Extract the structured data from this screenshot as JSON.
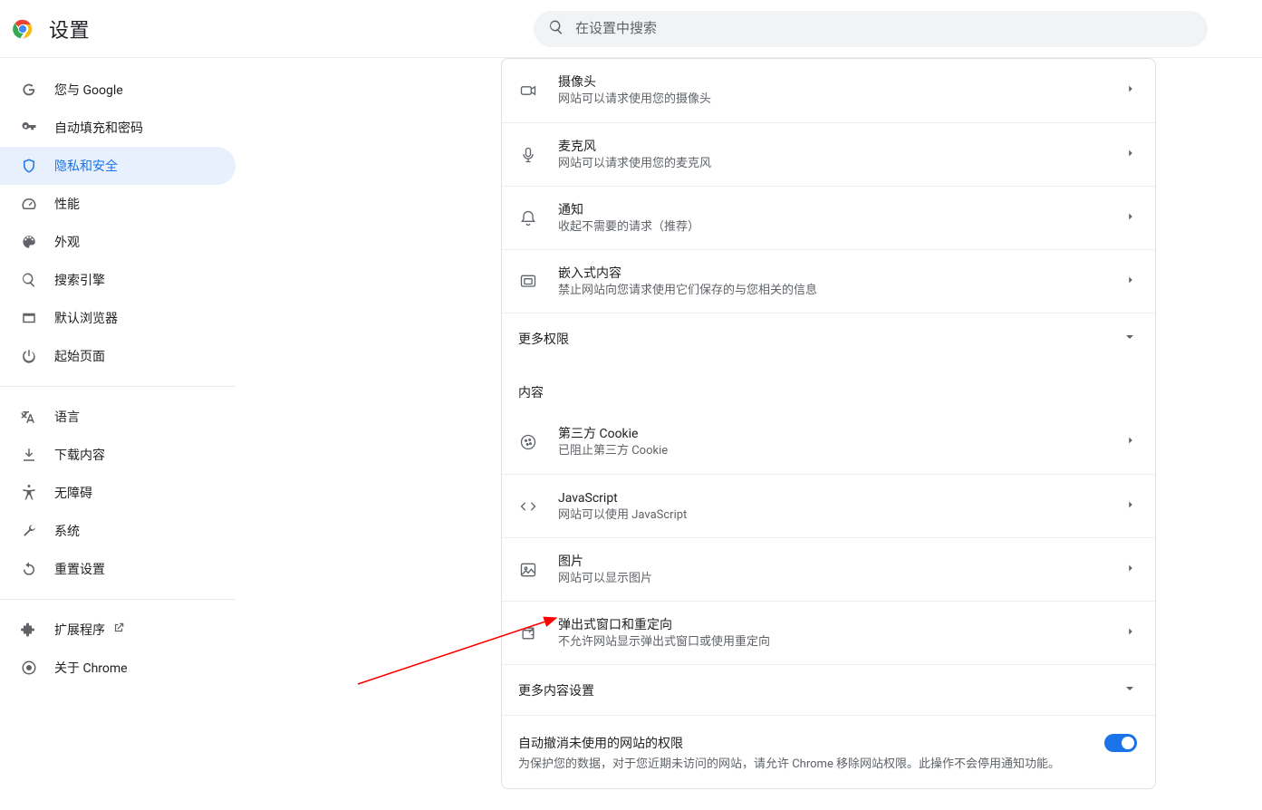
{
  "header": {
    "title": "设置",
    "search_placeholder": "在设置中搜索"
  },
  "sidebar": {
    "items": [
      {
        "label": "您与 Google",
        "name": "sidebar-item-you-and-google"
      },
      {
        "label": "自动填充和密码",
        "name": "sidebar-item-autofill"
      },
      {
        "label": "隐私和安全",
        "name": "sidebar-item-privacy",
        "active": true
      },
      {
        "label": "性能",
        "name": "sidebar-item-performance"
      },
      {
        "label": "外观",
        "name": "sidebar-item-appearance"
      },
      {
        "label": "搜索引擎",
        "name": "sidebar-item-search-engine"
      },
      {
        "label": "默认浏览器",
        "name": "sidebar-item-default-browser"
      },
      {
        "label": "起始页面",
        "name": "sidebar-item-on-startup"
      }
    ],
    "secondary": [
      {
        "label": "语言",
        "name": "sidebar-item-languages"
      },
      {
        "label": "下载内容",
        "name": "sidebar-item-downloads"
      },
      {
        "label": "无障碍",
        "name": "sidebar-item-accessibility"
      },
      {
        "label": "系统",
        "name": "sidebar-item-system"
      },
      {
        "label": "重置设置",
        "name": "sidebar-item-reset"
      }
    ],
    "tertiary": [
      {
        "label": "扩展程序",
        "name": "sidebar-item-extensions",
        "external": true
      },
      {
        "label": "关于 Chrome",
        "name": "sidebar-item-about"
      }
    ]
  },
  "permissions": {
    "rows": [
      {
        "title": "摄像头",
        "sub": "网站可以请求使用您的摄像头",
        "icon": "camera-icon",
        "name": "row-camera"
      },
      {
        "title": "麦克风",
        "sub": "网站可以请求使用您的麦克风",
        "icon": "microphone-icon",
        "name": "row-microphone"
      },
      {
        "title": "通知",
        "sub": "收起不需要的请求（推荐）",
        "icon": "bell-icon",
        "name": "row-notifications"
      },
      {
        "title": "嵌入式内容",
        "sub": "禁止网站向您请求使用它们保存的与您相关的信息",
        "icon": "embed-icon",
        "name": "row-embedded"
      }
    ],
    "more_label": "更多权限"
  },
  "content": {
    "section_label": "内容",
    "rows": [
      {
        "title": "第三方 Cookie",
        "sub": "已阻止第三方 Cookie",
        "icon": "cookie-icon",
        "name": "row-cookies"
      },
      {
        "title": "JavaScript",
        "sub": "网站可以使用 JavaScript",
        "icon": "code-icon",
        "name": "row-javascript"
      },
      {
        "title": "图片",
        "sub": "网站可以显示图片",
        "icon": "image-icon",
        "name": "row-images"
      },
      {
        "title": "弹出式窗口和重定向",
        "sub": "不允许网站显示弹出式窗口或使用重定向",
        "icon": "popup-icon",
        "name": "row-popups"
      }
    ],
    "more_label": "更多内容设置",
    "autorevoke": {
      "title": "自动撤消未使用的网站的权限",
      "sub": "为保护您的数据，对于您近期未访问的网站，请允许 Chrome 移除网站权限。此操作不会停用通知功能。"
    }
  }
}
